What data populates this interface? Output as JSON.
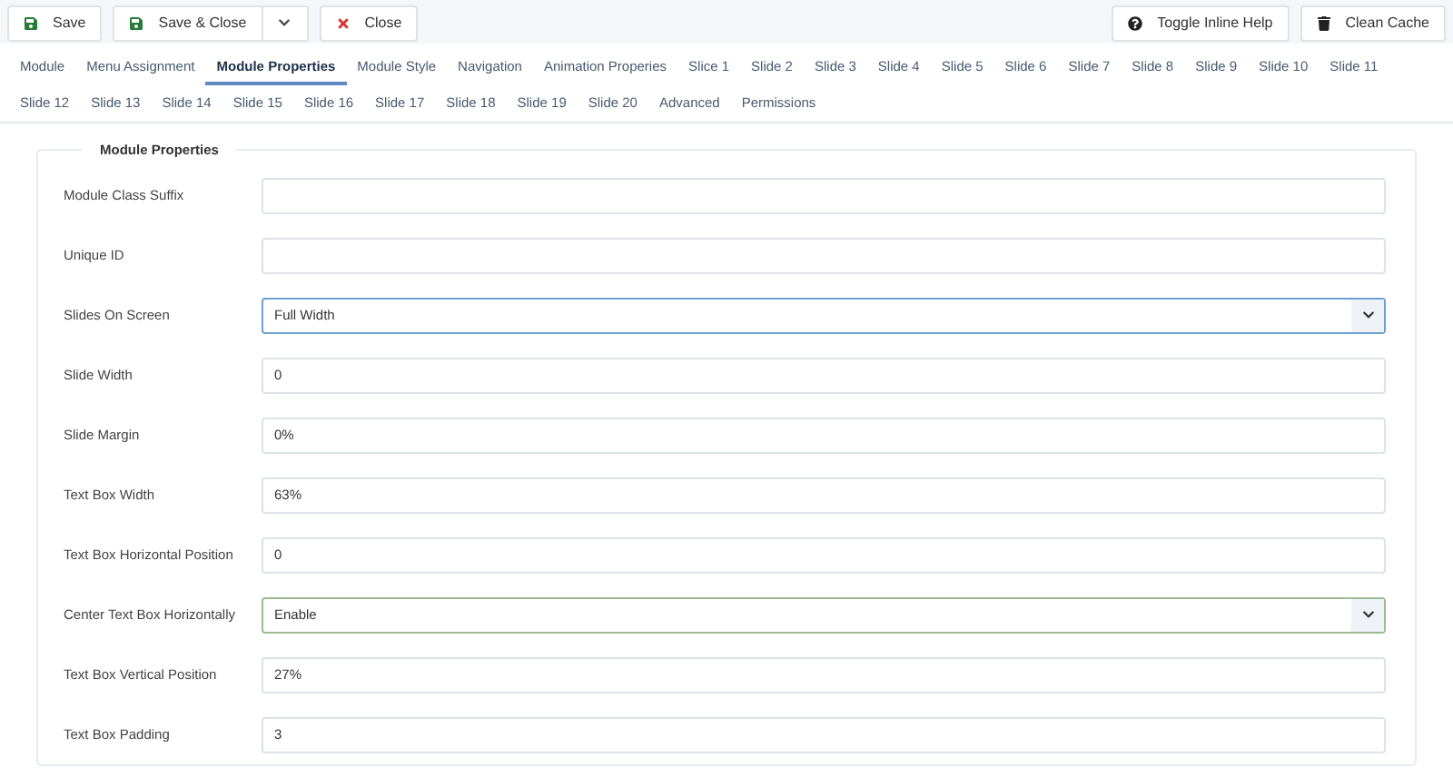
{
  "toolbar": {
    "left": [
      {
        "label": "Save",
        "kind": "save"
      },
      {
        "label": "Save & Close",
        "kind": "split"
      },
      {
        "label": "Close",
        "kind": "close"
      }
    ],
    "right": [
      {
        "label": "Toggle Inline Help",
        "kind": "help"
      },
      {
        "label": "Clean Cache",
        "kind": "cache"
      }
    ]
  },
  "tabs": [
    {
      "label": "Module",
      "selected": false
    },
    {
      "label": "Menu Assignment",
      "selected": false
    },
    {
      "label": "Module Properties",
      "selected": true
    },
    {
      "label": "Module Style",
      "selected": false
    },
    {
      "label": "Navigation",
      "selected": false
    },
    {
      "label": "Animation Properies",
      "selected": false
    },
    {
      "label": "Slice 1",
      "selected": false
    },
    {
      "label": "Slide 2",
      "selected": false
    },
    {
      "label": "Slide 3",
      "selected": false
    },
    {
      "label": "Slide 4",
      "selected": false
    },
    {
      "label": "Slide 5",
      "selected": false
    },
    {
      "label": "Slide 6",
      "selected": false
    },
    {
      "label": "Slide 7",
      "selected": false
    },
    {
      "label": "Slide 8",
      "selected": false
    },
    {
      "label": "Slide 9",
      "selected": false
    },
    {
      "label": "Slide 10",
      "selected": false
    },
    {
      "label": "Slide 11",
      "selected": false
    },
    {
      "label": "Slide 12",
      "selected": false
    },
    {
      "label": "Slide 13",
      "selected": false
    },
    {
      "label": "Slide 14",
      "selected": false
    },
    {
      "label": "Slide 15",
      "selected": false
    },
    {
      "label": "Slide 16",
      "selected": false
    },
    {
      "label": "Slide 17",
      "selected": false
    },
    {
      "label": "Slide 18",
      "selected": false
    },
    {
      "label": "Slide 19",
      "selected": false
    },
    {
      "label": "Slide 20",
      "selected": false
    },
    {
      "label": "Advanced",
      "selected": false
    },
    {
      "label": "Permissions",
      "selected": false
    }
  ],
  "fieldset": {
    "legend": "Module Properties",
    "fields": [
      {
        "label": "Module Class Suffix",
        "kind": "text"
      },
      {
        "label": "Unique ID",
        "kind": "text"
      },
      {
        "label": "Slides On Screen",
        "kind": "select",
        "value": "Full Width",
        "focused": true
      },
      {
        "label": "Slide Width",
        "kind": "text",
        "value": "0"
      },
      {
        "label": "Slide Margin",
        "kind": "text",
        "value": "0%"
      },
      {
        "label": "Text Box Width",
        "kind": "text",
        "value": "63%"
      },
      {
        "label": "Text Box Horizontal Position",
        "kind": "text",
        "value": "0"
      },
      {
        "label": "Center Text Box Horizontally",
        "kind": "select",
        "value": "Enable",
        "focused": false
      },
      {
        "label": "Text Box Vertical Position",
        "kind": "text",
        "value": "27%"
      },
      {
        "label": "Text Box Padding",
        "kind": "text",
        "value": "3"
      }
    ]
  }
}
